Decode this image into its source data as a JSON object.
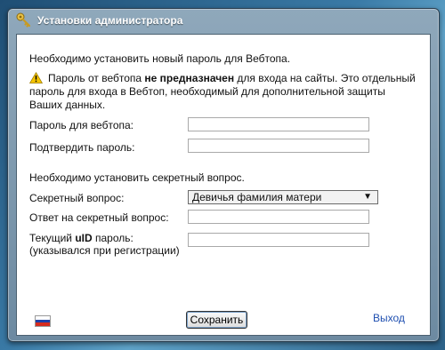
{
  "window": {
    "title": "Установки администратора"
  },
  "form": {
    "intro": "Необходимо установить новый пароль для Вебтопа.",
    "warning": {
      "part1": "Пароль от вебтопа ",
      "bold": "не предназначен",
      "part2": " для входа на сайты. Это отдельный пароль для входа в Вебтоп, необходимый для дополнительной защиты Ваших данных."
    },
    "password_label": "Пароль для вебтопа:",
    "confirm_label": "Подтвердить пароль:",
    "secret_section": "Необходимо установить секретный вопрос.",
    "secret_question_label": "Секретный вопрос:",
    "secret_question_value": "Девичья фамилия матери",
    "secret_answer_label": "Ответ на секретный вопрос:",
    "uid_label_prefix": "Текущий ",
    "uid_label_bold": "uID",
    "uid_label_suffix": " пароль:",
    "uid_label_note": "(указывался при регистрации)",
    "save_label": "Сохранить",
    "exit_label": "Выход"
  },
  "icons": {
    "title": "key-icon",
    "warning": "warning-icon",
    "language": "russian-flag-icon"
  },
  "colors": {
    "link": "#1f4fb0",
    "warning": "#f5c400"
  }
}
